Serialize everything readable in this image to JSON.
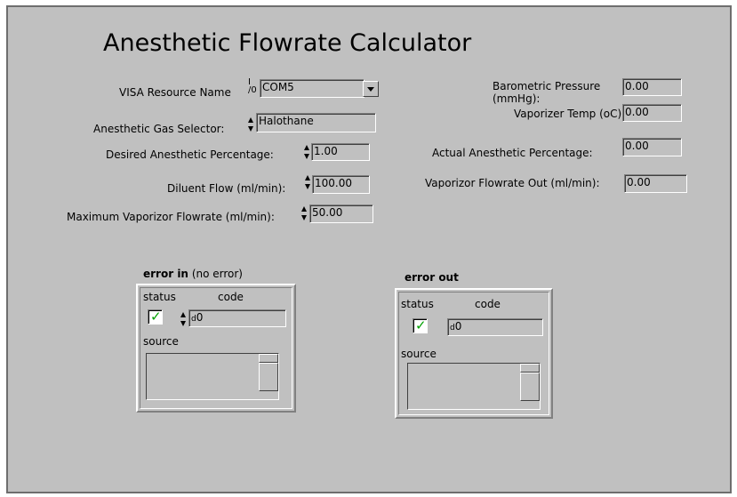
{
  "title": "Anesthetic Flowrate Calculator",
  "inputs": {
    "visa_label": "VISA Resource Name",
    "visa_prefix": "I/0",
    "visa_value": "COM5",
    "gas_label": "Anesthetic Gas Selector:",
    "gas_value": "Halothane",
    "desired_label": "Desired Anesthetic Percentage:",
    "desired_value": "1.00",
    "diluent_label": "Diluent Flow (ml/min):",
    "diluent_value": "100.00",
    "maxvap_label": "Maximum Vaporizor Flowrate (ml/min):",
    "maxvap_value": "50.00"
  },
  "outputs": {
    "baro_label": "Barometric Pressure (mmHg):",
    "baro_value": "0.00",
    "vaptemp_label": "Vaporizer Temp (oC):",
    "vaptemp_value": "0.00",
    "actual_label": "Actual Anesthetic Percentage:",
    "actual_value": "0.00",
    "vapflow_label": "Vaporizor Flowrate Out (ml/min):",
    "vapflow_value": "0.00"
  },
  "error_in": {
    "title": "error in",
    "subtitle": "(no error)",
    "status_label": "status",
    "code_label": "code",
    "code_radix": "d",
    "code_value": "0",
    "source_label": "source",
    "status_ok": true
  },
  "error_out": {
    "title": "error out",
    "status_label": "status",
    "code_label": "code",
    "code_radix": "d",
    "code_value": "0",
    "source_label": "source",
    "status_ok": true
  },
  "icons": {
    "check": "check-icon",
    "spin": "spin-arrows-icon",
    "dropdown": "chevron-down-icon"
  }
}
